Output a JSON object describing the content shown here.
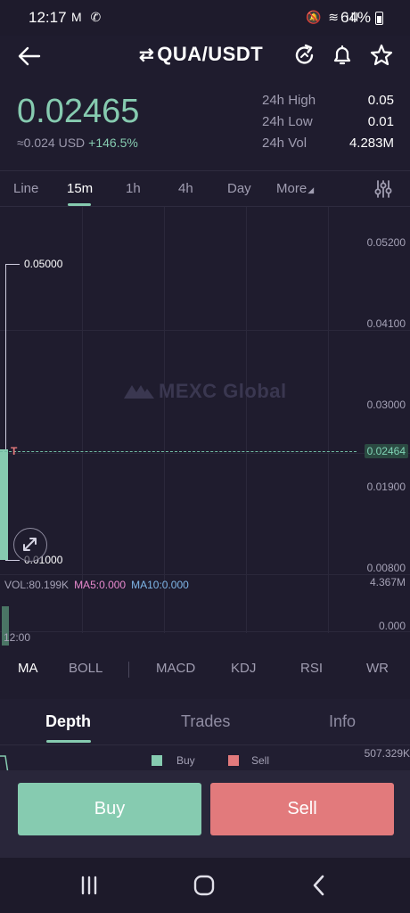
{
  "status_bar": {
    "time": "12:17",
    "left_icons": "M ✆",
    "right_icons": "🔕 ≋ ıll",
    "battery": "64%"
  },
  "header": {
    "pair": "QUA/USDT",
    "swap_icon": "swap-arrows-icon",
    "icons": [
      "back-arrow-icon",
      "refresh-icon",
      "bell-icon",
      "star-icon"
    ]
  },
  "price": {
    "last": "0.02465",
    "usd": "≈0.024 USD",
    "change": "+146.5%",
    "stats": [
      {
        "label": "24h High",
        "value": "0.05"
      },
      {
        "label": "24h Low",
        "value": "0.01"
      },
      {
        "label": "24h Vol",
        "value": "4.283M"
      }
    ]
  },
  "timeframes": {
    "items": [
      "Line",
      "15m",
      "1h",
      "4h",
      "Day",
      "More"
    ],
    "active": "15m"
  },
  "chart": {
    "watermark": "MEXC Global",
    "y_axis": [
      "0.05200",
      "0.04100",
      "0.03000",
      "0.01900",
      "0.00800"
    ],
    "high_label": "0.05000",
    "low_label": "0.01000",
    "current_price_tag": "0.02464",
    "current_marker": "T",
    "volume": {
      "vol": "VOL:80.199K",
      "ma5": "MA5:0.000",
      "ma10": "MA10:0.000",
      "max": "4.367M",
      "min": "0.000"
    },
    "x_label": "12:00",
    "colors": {
      "up": "#86cbb0",
      "down": "#e27a7c",
      "ma5": "#e889ce",
      "ma10": "#7fb6e8"
    }
  },
  "indicators": {
    "items": [
      "MA",
      "BOLL",
      "MACD",
      "KDJ",
      "RSI",
      "WR"
    ],
    "active": "MA"
  },
  "depth": {
    "tabs": [
      "Depth",
      "Trades",
      "Info"
    ],
    "active": "Depth",
    "buy_label": "Buy",
    "sell_label": "Sell",
    "max_label": "507.329K"
  },
  "actions": {
    "buy": "Buy",
    "sell": "Sell"
  },
  "navbar": {
    "icons": [
      "recent-apps-icon",
      "home-icon",
      "back-icon"
    ]
  }
}
